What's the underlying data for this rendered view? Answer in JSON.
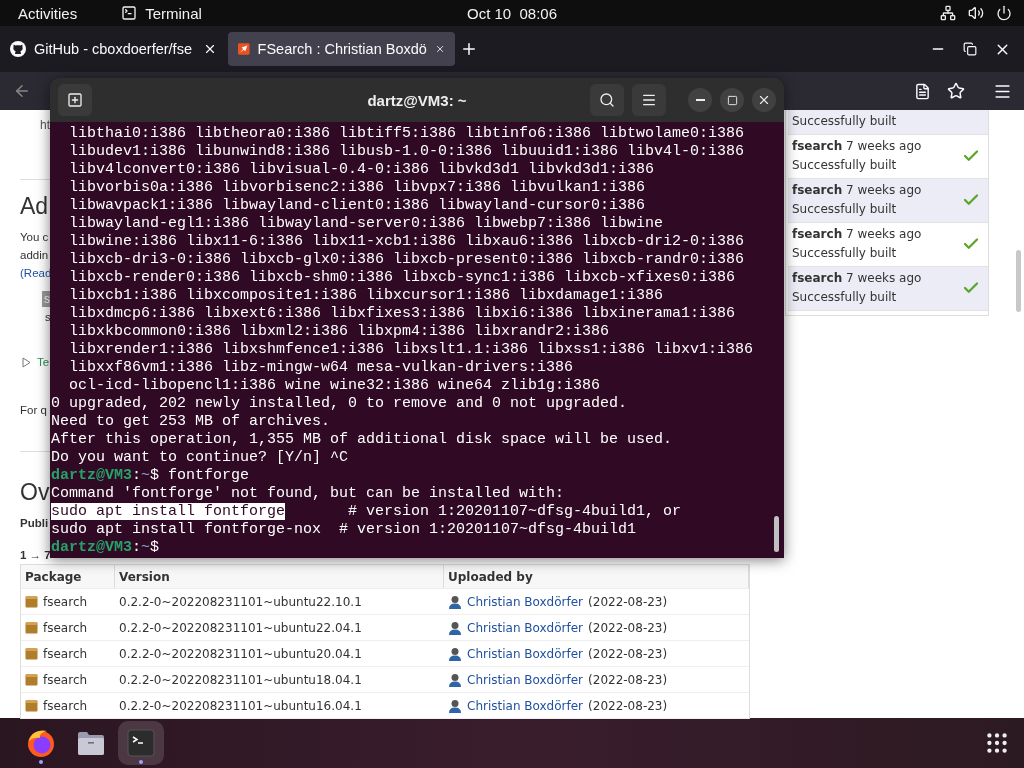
{
  "top_bar": {
    "activities": "Activities",
    "app": "Terminal",
    "clock": "Oct 10  08:06"
  },
  "browser": {
    "tabs": [
      {
        "kind": "github",
        "title": "GitHub - cboxdoerfer/fse",
        "selected": false
      },
      {
        "kind": "launchpad",
        "title": "FSearch : Christian Boxdö",
        "selected": true
      }
    ],
    "page": {
      "fragments": [
        {
          "kind": "url",
          "text": "ht"
        },
        {
          "kind": "rule"
        },
        {
          "kind": "heading",
          "text": "Ad"
        },
        {
          "kind": "text",
          "text": "You c"
        },
        {
          "kind": "text",
          "text": "addin"
        },
        {
          "kind": "link",
          "text": "(Read"
        },
        {
          "kind": "code",
          "text": "s"
        },
        {
          "kind": "indent",
          "text": "s"
        },
        {
          "kind": "disclosure",
          "text": "Te"
        },
        {
          "kind": "para",
          "text": "For q"
        },
        {
          "kind": "rule"
        },
        {
          "kind": "heading",
          "text": "Ov"
        },
        {
          "kind": "bold",
          "text": "Publi"
        },
        {
          "kind": "bold",
          "text": "1 → 7"
        }
      ],
      "builds": [
        {
          "status": "Successfully built"
        },
        {
          "name": "fsearch",
          "age": "7 weeks ago",
          "status": "Successfully built"
        },
        {
          "name": "fsearch",
          "age": "7 weeks ago",
          "status": "Successfully built"
        },
        {
          "name": "fsearch",
          "age": "7 weeks ago",
          "status": "Successfully built"
        },
        {
          "name": "fsearch",
          "age": "7 weeks ago",
          "status": "Successfully built"
        }
      ],
      "table": {
        "columns": [
          "Package",
          "Version",
          "Uploaded by"
        ],
        "rows": [
          {
            "package": "fsearch",
            "version": "0.2.2-0~202208231101~ubuntu22.10.1",
            "uploader": "Christian Boxdörfer",
            "date": "(2022-08-23)"
          },
          {
            "package": "fsearch",
            "version": "0.2.2-0~202208231101~ubuntu22.04.1",
            "uploader": "Christian Boxdörfer",
            "date": "(2022-08-23)"
          },
          {
            "package": "fsearch",
            "version": "0.2.2-0~202208231101~ubuntu20.04.1",
            "uploader": "Christian Boxdörfer",
            "date": "(2022-08-23)"
          },
          {
            "package": "fsearch",
            "version": "0.2.2-0~202208231101~ubuntu18.04.1",
            "uploader": "Christian Boxdörfer",
            "date": "(2022-08-23)"
          },
          {
            "package": "fsearch",
            "version": "0.2.2-0~202208231101~ubuntu16.04.1",
            "uploader": "Christian Boxdörfer",
            "date": "(2022-08-23)"
          }
        ]
      }
    }
  },
  "terminal": {
    "title": "dartz@VM3: ~",
    "lines": [
      {
        "text": "  libthai0:i386 libtheora0:i386 libtiff5:i386 libtinfo6:i386 libtwolame0:i386"
      },
      {
        "text": "  libudev1:i386 libunwind8:i386 libusb-1.0-0:i386 libuuid1:i386 libv4l-0:i386"
      },
      {
        "text": "  libv4lconvert0:i386 libvisual-0.4-0:i386 libvkd3d1 libvkd3d1:i386"
      },
      {
        "text": "  libvorbis0a:i386 libvorbisenc2:i386 libvpx7:i386 libvulkan1:i386"
      },
      {
        "text": "  libwavpack1:i386 libwayland-client0:i386 libwayland-cursor0:i386"
      },
      {
        "text": "  libwayland-egl1:i386 libwayland-server0:i386 libwebp7:i386 libwine"
      },
      {
        "text": "  libwine:i386 libx11-6:i386 libx11-xcb1:i386 libxau6:i386 libxcb-dri2-0:i386"
      },
      {
        "text": "  libxcb-dri3-0:i386 libxcb-glx0:i386 libxcb-present0:i386 libxcb-randr0:i386"
      },
      {
        "text": "  libxcb-render0:i386 libxcb-shm0:i386 libxcb-sync1:i386 libxcb-xfixes0:i386"
      },
      {
        "text": "  libxcb1:i386 libxcomposite1:i386 libxcursor1:i386 libxdamage1:i386"
      },
      {
        "text": "  libxdmcp6:i386 libxext6:i386 libxfixes3:i386 libxi6:i386 libxinerama1:i386"
      },
      {
        "text": "  libxkbcommon0:i386 libxml2:i386 libxpm4:i386 libxrandr2:i386"
      },
      {
        "text": "  libxrender1:i386 libxshmfence1:i386 libxslt1.1:i386 libxss1:i386 libxv1:i386"
      },
      {
        "text": "  libxxf86vm1:i386 libz-mingw-w64 mesa-vulkan-drivers:i386"
      },
      {
        "text": "  ocl-icd-libopencl1:i386 wine wine32:i386 wine64 zlib1g:i386"
      },
      {
        "text": "0 upgraded, 202 newly installed, 0 to remove and 0 not upgraded."
      },
      {
        "text": "Need to get 253 MB of archives."
      },
      {
        "text": "After this operation, 1,355 MB of additional disk space will be used."
      },
      {
        "text": "Do you want to continue? [Y/n] ^C"
      },
      {
        "kind": "prompt",
        "user": "dartz@VM3",
        "colon": ":",
        "path": "~",
        "command": "$ fontforge"
      },
      {
        "text": "Command 'fontforge' not found, but can be installed with:"
      },
      {
        "kind": "selection",
        "selection": "sudo apt install fontforge",
        "text": "       # version 1:20201107~dfsg-4build1, or"
      },
      {
        "text": "sudo apt install fontforge-nox  # version 1:20201107~dfsg-4build1"
      },
      {
        "kind": "prompt",
        "user": "dartz@VM3",
        "colon": ":",
        "path": "~",
        "command": "$"
      }
    ]
  },
  "dock": [
    {
      "kind": "browser",
      "running": true,
      "selected": false
    },
    {
      "kind": "files",
      "running": false,
      "selected": false
    },
    {
      "kind": "terminal",
      "running": true,
      "selected": true
    }
  ]
}
